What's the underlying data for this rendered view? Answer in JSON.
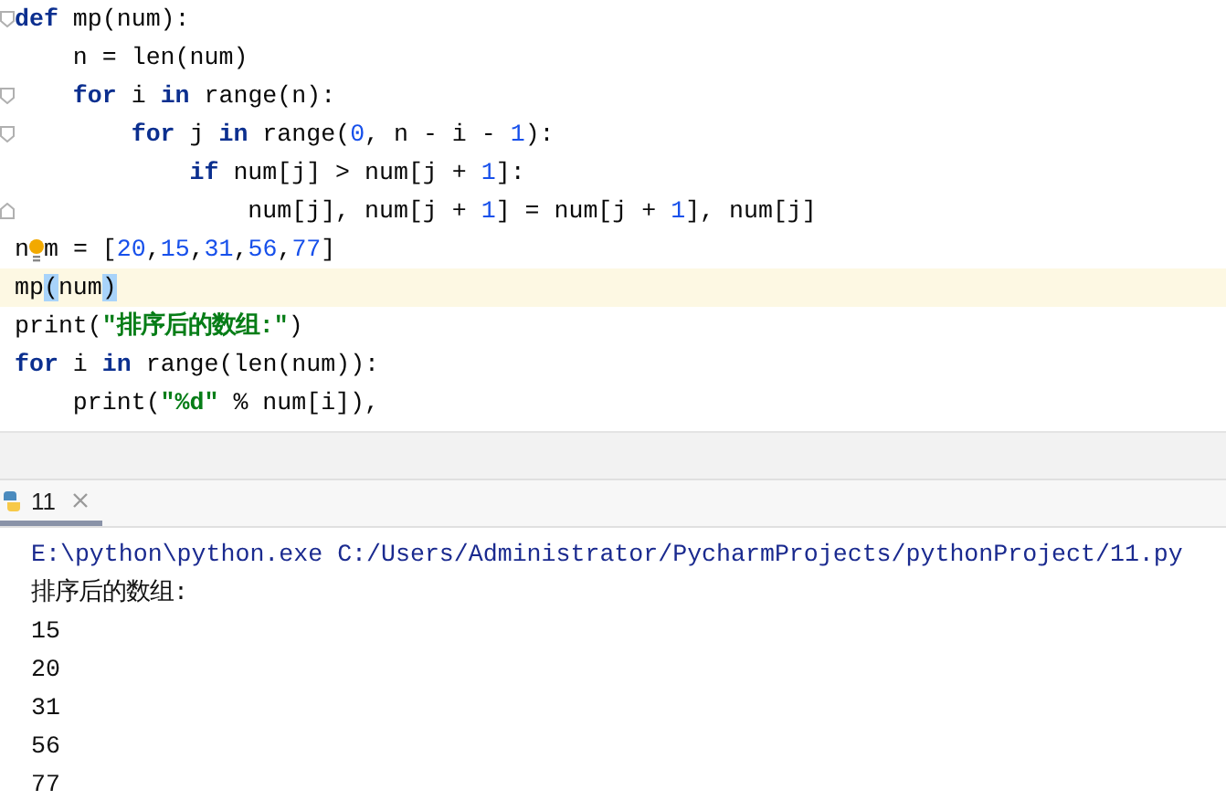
{
  "editor": {
    "lines": [
      {
        "fold_start": true,
        "tokens": [
          {
            "kind": "kw",
            "text": "def"
          },
          {
            "kind": "text",
            "text": " mp(num):"
          }
        ]
      },
      {
        "tokens": [
          {
            "kind": "text",
            "text": "    n = len(num)"
          }
        ]
      },
      {
        "fold_start": true,
        "tokens": [
          {
            "kind": "kw",
            "text": "    for"
          },
          {
            "kind": "text",
            "text": " i "
          },
          {
            "kind": "kw",
            "text": "in"
          },
          {
            "kind": "text",
            "text": " range(n):"
          }
        ]
      },
      {
        "fold_start": true,
        "tokens": [
          {
            "kind": "kw",
            "text": "        for"
          },
          {
            "kind": "text",
            "text": " j "
          },
          {
            "kind": "kw",
            "text": "in"
          },
          {
            "kind": "text",
            "text": " range("
          },
          {
            "kind": "num",
            "text": "0"
          },
          {
            "kind": "text",
            "text": ", n - i - "
          },
          {
            "kind": "num",
            "text": "1"
          },
          {
            "kind": "text",
            "text": "):"
          }
        ]
      },
      {
        "tokens": [
          {
            "kind": "kw",
            "text": "            if"
          },
          {
            "kind": "text",
            "text": " num[j] > num[j + "
          },
          {
            "kind": "num",
            "text": "1"
          },
          {
            "kind": "text",
            "text": "]:"
          }
        ]
      },
      {
        "fold_end": true,
        "tokens": [
          {
            "kind": "text",
            "text": "                num[j], num[j + "
          },
          {
            "kind": "num",
            "text": "1"
          },
          {
            "kind": "text",
            "text": "] = num[j + "
          },
          {
            "kind": "num",
            "text": "1"
          },
          {
            "kind": "text",
            "text": "], num[j]"
          }
        ]
      },
      {
        "tokens": [
          {
            "kind": "text",
            "text": "n"
          },
          {
            "kind": "bulb"
          },
          {
            "kind": "text",
            "text": "m = ["
          },
          {
            "kind": "num",
            "text": "20"
          },
          {
            "kind": "text",
            "text": ","
          },
          {
            "kind": "num",
            "text": "15"
          },
          {
            "kind": "text",
            "text": ","
          },
          {
            "kind": "num",
            "text": "31"
          },
          {
            "kind": "text",
            "text": ","
          },
          {
            "kind": "num",
            "text": "56"
          },
          {
            "kind": "text",
            "text": ","
          },
          {
            "kind": "num",
            "text": "77"
          },
          {
            "kind": "text",
            "text": "]"
          }
        ]
      },
      {
        "current": true,
        "tokens": [
          {
            "kind": "text",
            "text": "mp"
          },
          {
            "kind": "match",
            "text": "("
          },
          {
            "kind": "text",
            "text": "num"
          },
          {
            "kind": "match",
            "text": ")"
          }
        ]
      },
      {
        "tokens": [
          {
            "kind": "text",
            "text": "print("
          },
          {
            "kind": "str",
            "text": "\"排序后的数组:\""
          },
          {
            "kind": "text",
            "text": ")"
          }
        ]
      },
      {
        "tokens": [
          {
            "kind": "kw",
            "text": "for"
          },
          {
            "kind": "text",
            "text": " i "
          },
          {
            "kind": "kw",
            "text": "in"
          },
          {
            "kind": "text",
            "text": " range(len(num)):"
          }
        ]
      },
      {
        "tokens": [
          {
            "kind": "text",
            "text": "    print("
          },
          {
            "kind": "str",
            "text": "\"%d\""
          },
          {
            "kind": "text",
            "text": " % num[i]),"
          }
        ]
      }
    ]
  },
  "run_tab": {
    "label": "11",
    "selected": true
  },
  "console": [
    {
      "kind": "command",
      "text": "E:\\python\\python.exe C:/Users/Administrator/PycharmProjects/pythonProject/11.py"
    },
    {
      "kind": "output",
      "text": "排序后的数组:"
    },
    {
      "kind": "output",
      "text": "15"
    },
    {
      "kind": "output",
      "text": "20"
    },
    {
      "kind": "output",
      "text": "31"
    },
    {
      "kind": "output",
      "text": "56"
    },
    {
      "kind": "output",
      "text": "77"
    }
  ]
}
